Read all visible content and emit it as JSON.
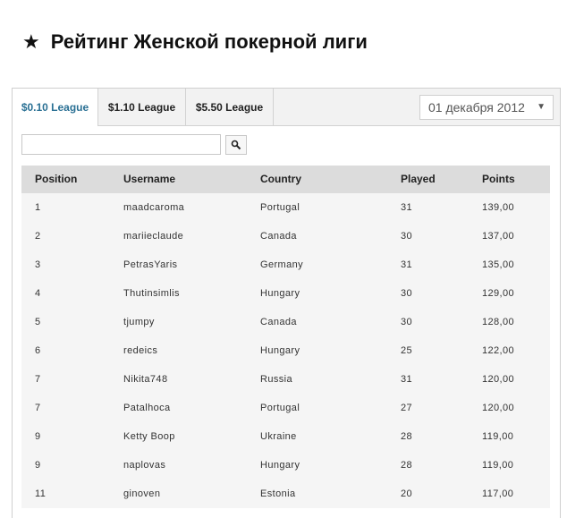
{
  "page": {
    "title": "Рейтинг Женской покерной лиги",
    "title_icon": "star-icon"
  },
  "tabs": [
    {
      "label": "$0.10 League",
      "active": true
    },
    {
      "label": "$1.10 League",
      "active": false
    },
    {
      "label": "$5.50 League",
      "active": false
    }
  ],
  "date_select": {
    "value": "01 декабря 2012"
  },
  "search": {
    "value": "",
    "button_icon": "search-icon"
  },
  "table": {
    "headers": [
      "Position",
      "Username",
      "Country",
      "Played",
      "Points"
    ],
    "rows": [
      [
        "1",
        "maadcaroma",
        "Portugal",
        "31",
        "139,00"
      ],
      [
        "2",
        "mariieclaude",
        "Canada",
        "30",
        "137,00"
      ],
      [
        "3",
        "PetrasYaris",
        "Germany",
        "31",
        "135,00"
      ],
      [
        "4",
        "Thutinsimlis",
        "Hungary",
        "30",
        "129,00"
      ],
      [
        "5",
        "tjumpy",
        "Canada",
        "30",
        "128,00"
      ],
      [
        "6",
        "redeics",
        "Hungary",
        "25",
        "122,00"
      ],
      [
        "7",
        "Nikita748",
        "Russia",
        "31",
        "120,00"
      ],
      [
        "7",
        "Patalhoca",
        "Portugal",
        "27",
        "120,00"
      ],
      [
        "9",
        "Ketty Boop",
        "Ukraine",
        "28",
        "119,00"
      ],
      [
        "9",
        "naplovas",
        "Hungary",
        "28",
        "119,00"
      ],
      [
        "11",
        "ginoven",
        "Estonia",
        "20",
        "117,00"
      ]
    ]
  },
  "colors": {
    "active_tab_text": "#2a7094",
    "header_bg": "#dcdcdc",
    "row_bg": "#f5f5f5"
  }
}
